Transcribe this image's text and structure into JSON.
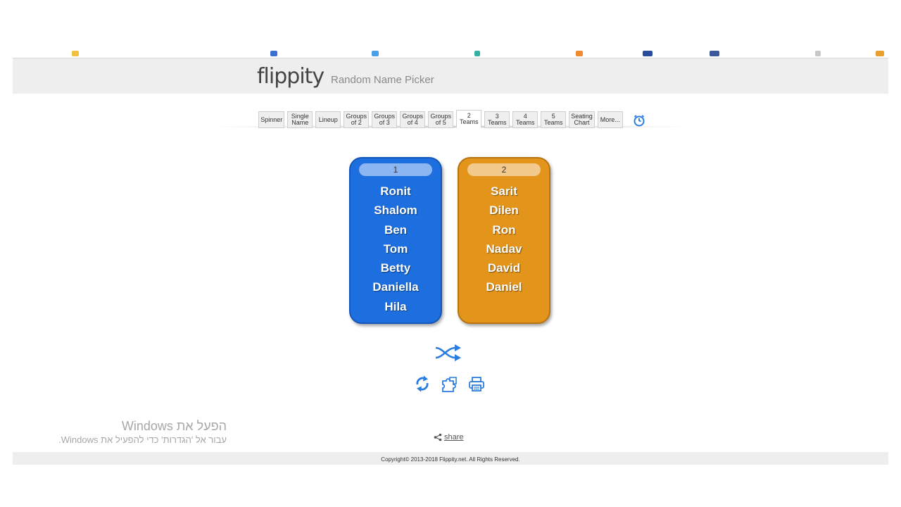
{
  "app": {
    "logo": "flippity",
    "title": "Random Name Picker"
  },
  "tabs": [
    {
      "label": "Spinner",
      "active": false
    },
    {
      "label": "Single\nName",
      "active": false
    },
    {
      "label": "Lineup",
      "active": false
    },
    {
      "label": "Groups\nof 2",
      "active": false
    },
    {
      "label": "Groups\nof 3",
      "active": false
    },
    {
      "label": "Groups\nof 4",
      "active": false
    },
    {
      "label": "Groups\nof 5",
      "active": false
    },
    {
      "label": "2\nTeams",
      "active": true
    },
    {
      "label": "3\nTeams",
      "active": false
    },
    {
      "label": "4\nTeams",
      "active": false
    },
    {
      "label": "5\nTeams",
      "active": false
    },
    {
      "label": "Seating\nChart",
      "active": false
    },
    {
      "label": "More...",
      "active": false
    }
  ],
  "teams": [
    {
      "number": "1",
      "color": "#1d6fe0",
      "members": [
        "Ronit",
        "Shalom",
        "Ben",
        "Tom",
        "Betty",
        "Daniella",
        "Hila"
      ]
    },
    {
      "number": "2",
      "color": "#e3941b",
      "members": [
        "Sarit",
        "Dilen",
        "Ron",
        "Nadav",
        "David",
        "Daniel"
      ]
    }
  ],
  "icons": {
    "timer": "stopwatch-icon",
    "shuffle": "shuffle-icon",
    "refresh": "refresh-icon",
    "puzzle": "puzzle-icon",
    "print": "print-icon",
    "share": "share-icon"
  },
  "accent_color": "#2b7de0",
  "windows_activation": {
    "line1": "הפעל את Windows",
    "line2": "עבור אל 'הגדרות' כדי להפעיל את Windows."
  },
  "share_label": "share",
  "footer": "Copyright© 2013-2018 Flippity.net. All Rights Reserved."
}
